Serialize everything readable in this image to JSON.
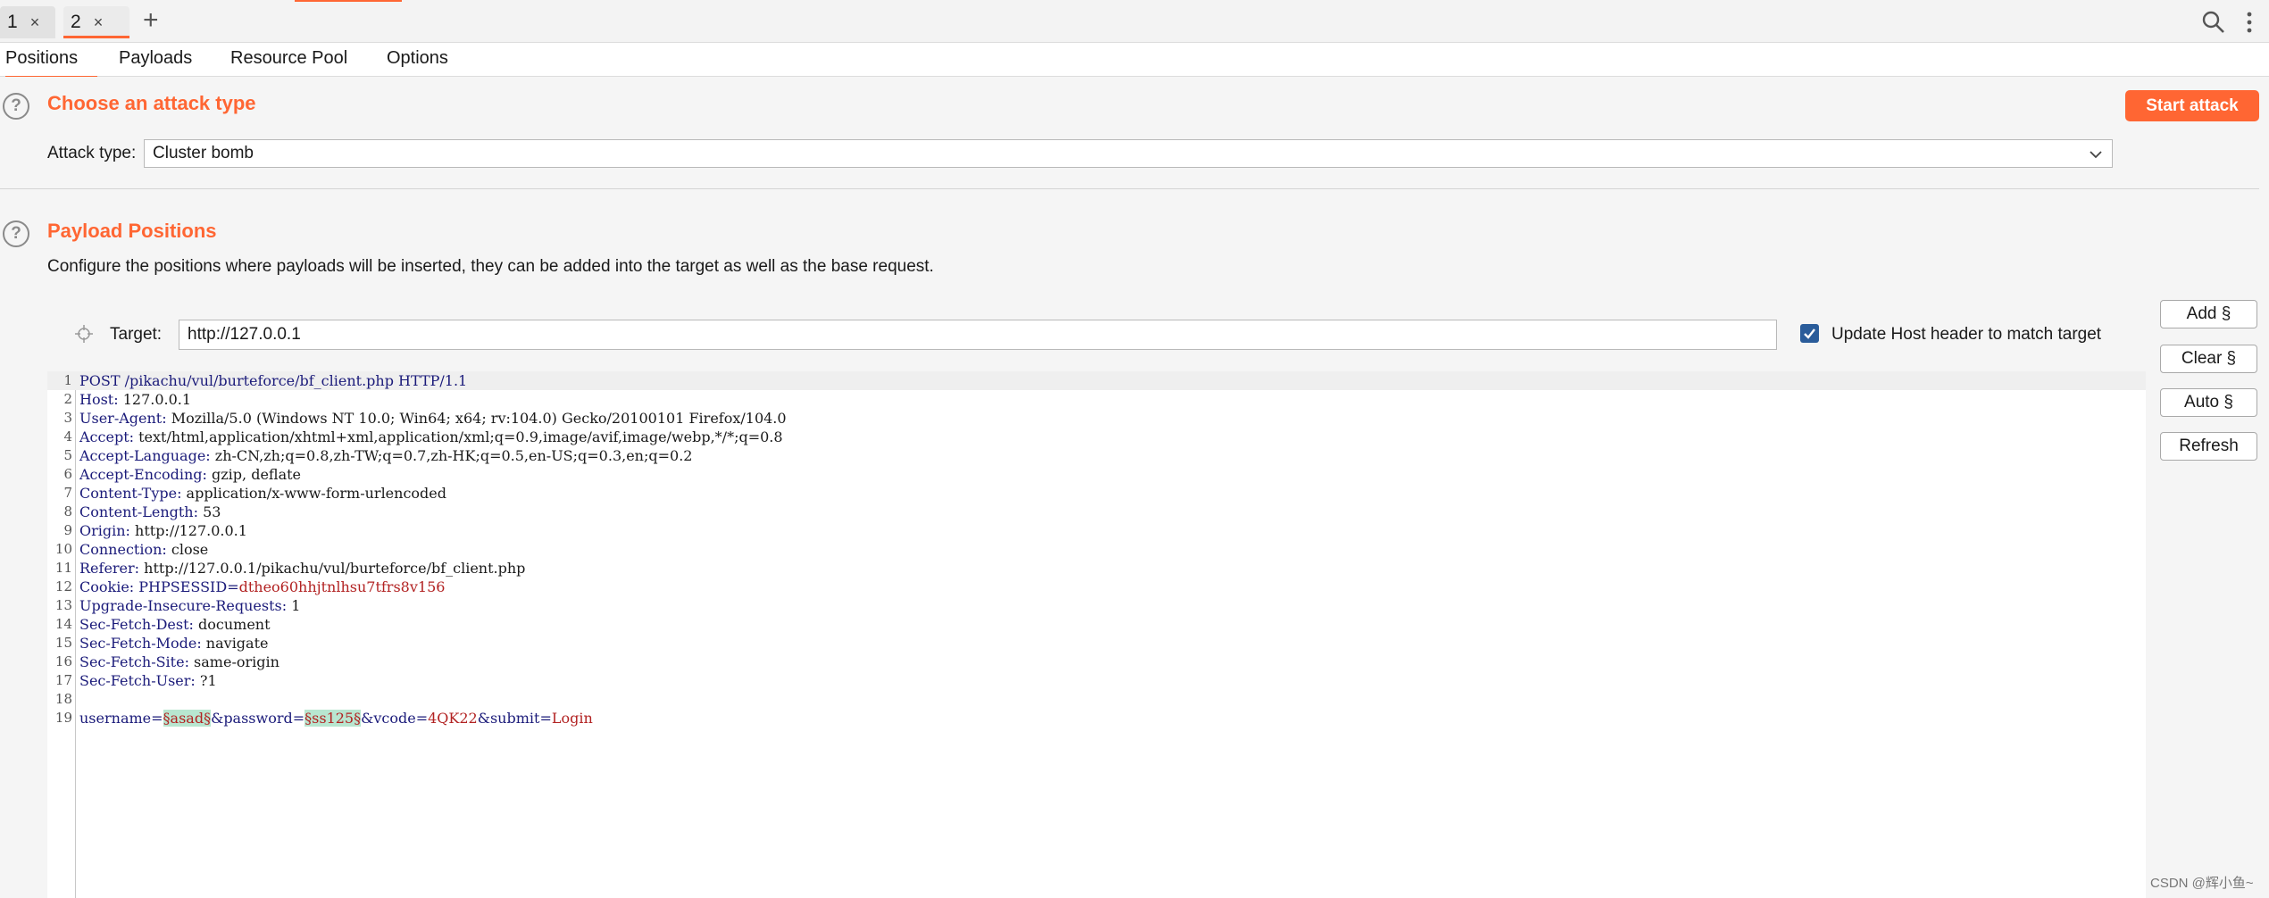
{
  "tabs": [
    {
      "label": "1",
      "close": "×"
    },
    {
      "label": "2",
      "close": "×"
    }
  ],
  "add_tab": "+",
  "subtabs": [
    "Positions",
    "Payloads",
    "Resource Pool",
    "Options"
  ],
  "attack": {
    "title": "Choose an attack type",
    "start_label": "Start attack",
    "type_label": "Attack type:",
    "type_value": "Cluster bomb"
  },
  "positions": {
    "title": "Payload Positions",
    "description": "Configure the positions where payloads will be inserted, they can be added into the target as well as the base request.",
    "target_label": "Target:",
    "target_value": "http://127.0.0.1",
    "update_host_label": "Update Host header to match target",
    "update_host_checked": true,
    "buttons": [
      "Add §",
      "Clear §",
      "Auto §",
      "Refresh"
    ]
  },
  "request_lines": [
    {
      "n": "1",
      "name": "POST /pikachu/vul/burteforce/bf_client.php HTTP/1.1",
      "value": ""
    },
    {
      "n": "2",
      "name": "Host:",
      "value": " 127.0.0.1"
    },
    {
      "n": "3",
      "name": "User-Agent:",
      "value": " Mozilla/5.0 (Windows NT 10.0; Win64; x64; rv:104.0) Gecko/20100101 Firefox/104.0"
    },
    {
      "n": "4",
      "name": "Accept:",
      "value": " text/html,application/xhtml+xml,application/xml;q=0.9,image/avif,image/webp,*/*;q=0.8"
    },
    {
      "n": "5",
      "name": "Accept-Language:",
      "value": " zh-CN,zh;q=0.8,zh-TW;q=0.7,zh-HK;q=0.5,en-US;q=0.3,en;q=0.2"
    },
    {
      "n": "6",
      "name": "Accept-Encoding:",
      "value": " gzip, deflate"
    },
    {
      "n": "7",
      "name": "Content-Type:",
      "value": " application/x-www-form-urlencoded"
    },
    {
      "n": "8",
      "name": "Content-Length:",
      "value": " 53"
    },
    {
      "n": "9",
      "name": "Origin:",
      "value": " http://127.0.0.1"
    },
    {
      "n": "10",
      "name": "Connection:",
      "value": " close"
    },
    {
      "n": "11",
      "name": "Referer:",
      "value": " http://127.0.0.1/pikachu/vul/burteforce/bf_client.php"
    },
    {
      "n": "12",
      "name": "Cookie:",
      "value": ""
    },
    {
      "n": "13",
      "name": "Upgrade-Insecure-Requests:",
      "value": " 1"
    },
    {
      "n": "14",
      "name": "Sec-Fetch-Dest:",
      "value": " document"
    },
    {
      "n": "15",
      "name": "Sec-Fetch-Mode:",
      "value": " navigate"
    },
    {
      "n": "16",
      "name": "Sec-Fetch-Site:",
      "value": " same-origin"
    },
    {
      "n": "17",
      "name": "Sec-Fetch-User:",
      "value": " ?1"
    },
    {
      "n": "18",
      "name": "",
      "value": ""
    },
    {
      "n": "19",
      "name": "",
      "value": ""
    }
  ],
  "cookie": {
    "name": " PHPSESSID",
    "eq": "=",
    "value": "dtheo60hhjtnlhsu7tfrs8v156"
  },
  "body": {
    "p1": "username",
    "eq1": "=",
    "m1": "§asad§",
    "amp1": "&",
    "p2": "password",
    "eq2": "=",
    "m2": "§ss125§",
    "amp2": "&",
    "p3": "vcode",
    "eq3": "=",
    "v3": "4QK22",
    "amp3": "&",
    "p4": "submit",
    "eq4": "=",
    "v4": "Login"
  },
  "watermark": "CSDN @辉小鱼~",
  "colors": {
    "accent": "#ff6633",
    "header_name": "#1b1b7a",
    "param_value": "#b22222",
    "marker_bg": "#b8e6d0"
  }
}
